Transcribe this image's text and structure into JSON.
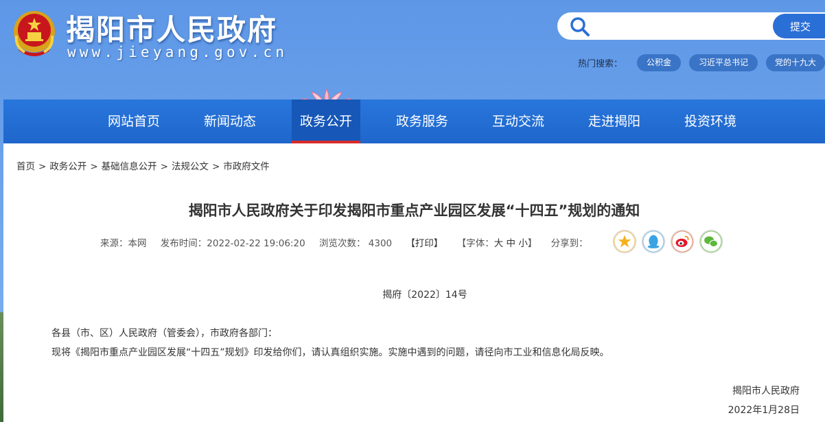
{
  "header": {
    "site_title": "揭阳市人民政府",
    "site_url": "www.jieyang.gov.cn",
    "search": {
      "placeholder": "",
      "submit_label": "提交"
    },
    "hot_search_label": "热门搜索：",
    "hot_tags": [
      "公积金",
      "习近平总书记",
      "党的十九大"
    ]
  },
  "nav": {
    "items": [
      "网站首页",
      "新闻动态",
      "政务公开",
      "政务服务",
      "互动交流",
      "走进揭阳",
      "投资环境"
    ],
    "active_index": 2
  },
  "breadcrumb": [
    "首页",
    "政务公开",
    "基础信息公开",
    "法规公文",
    "市政府文件"
  ],
  "breadcrumb_sep": ">",
  "article": {
    "title": "揭阳市人民政府关于印发揭阳市重点产业园区发展“十四五”规划的通知",
    "meta": {
      "source": "来源：本网",
      "published": "发布时间：2022-02-22 19:06:20",
      "views_label": "浏览次数：",
      "views": "4300",
      "print": "【打印】",
      "font_prefix": "【字体：",
      "font_large": "大",
      "font_medium": "中",
      "font_small": "小",
      "font_suffix": "】",
      "share_label": "分享到："
    },
    "share_icons": [
      "qzone-icon",
      "qq-icon",
      "weibo-icon",
      "wechat-icon"
    ],
    "doc_number": "揭府〔2022〕14号",
    "salutation": "各县（市、区）人民政府（管委会），市政府各部门：",
    "body": "现将《揭阳市重点产业园区发展“十四五”规划》印发给你们，请认真组织实施。实施中遇到的问题，请径向市工业和信息化局反映。",
    "signature_org": "揭阳市人民政府",
    "signature_date": "2022年1月28日"
  },
  "colors": {
    "header_bg": "#6aa0eb",
    "nav_bg": "#2170d4",
    "nav_active_underline": "#d92b2b",
    "submit_bg": "#2a6fd6",
    "hot_tag_bg": "#3a74c7"
  }
}
